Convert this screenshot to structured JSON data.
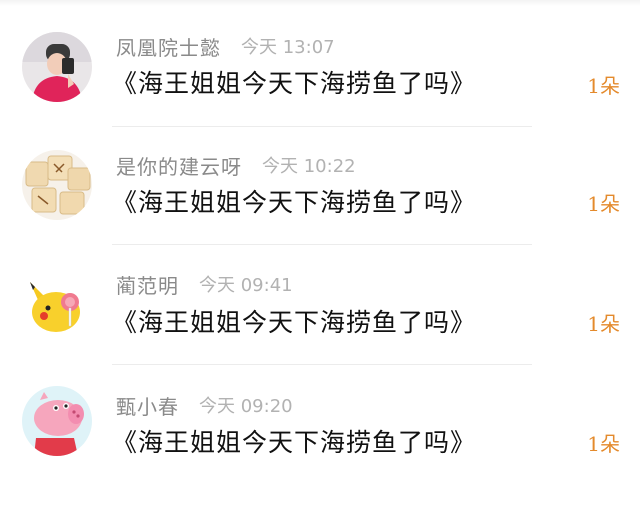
{
  "comments": [
    {
      "name": "凤凰院士懿",
      "time": "今天 13:07",
      "message": "《海王姐姐今天下海捞鱼了吗》",
      "gift": "1朵",
      "avatar_icon": "person-photo-avatar"
    },
    {
      "name": "是你的建云呀",
      "time": "今天 10:22",
      "message": "《海王姐姐今天下海捞鱼了吗》",
      "gift": "1朵",
      "avatar_icon": "mahjong-tiles-avatar"
    },
    {
      "name": "蔺范明",
      "time": "今天 09:41",
      "message": "《海王姐姐今天下海捞鱼了吗》",
      "gift": "1朵",
      "avatar_icon": "pikachu-avatar"
    },
    {
      "name": "甄小春",
      "time": "今天 09:20",
      "message": "《海王姐姐今天下海捞鱼了吗》",
      "gift": "1朵",
      "avatar_icon": "peppa-pig-avatar"
    }
  ],
  "colors": {
    "name": "#8a8a8a",
    "time": "#b2b2b2",
    "message": "#111111",
    "gift": "#e48a2c"
  }
}
